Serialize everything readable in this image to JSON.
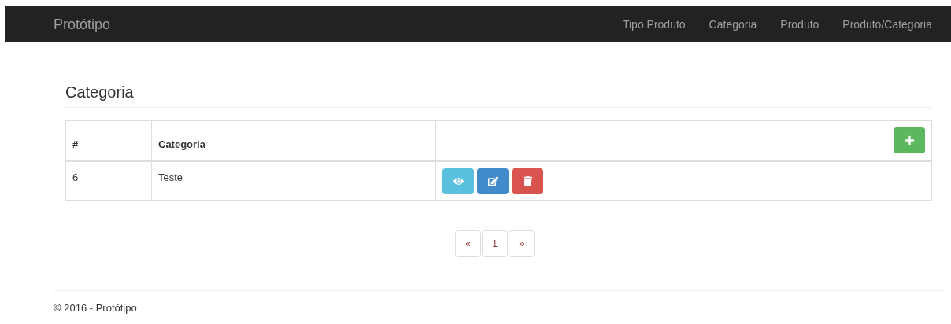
{
  "navbar": {
    "brand": "Protótipo",
    "links": [
      "Tipo Produto",
      "Categoria",
      "Produto",
      "Produto/Categoria"
    ]
  },
  "page": {
    "title": "Categoria"
  },
  "table": {
    "columns": [
      "#",
      "Categoria"
    ],
    "add_button": {
      "kind": "add"
    },
    "rows": [
      {
        "cells": [
          "6",
          "Teste"
        ],
        "actions": [
          {
            "kind": "view"
          },
          {
            "kind": "edit"
          },
          {
            "kind": "delete"
          }
        ]
      }
    ]
  },
  "pagination": [
    "«",
    "1",
    "»"
  ],
  "footer": "© 2016 - Protótipo"
}
